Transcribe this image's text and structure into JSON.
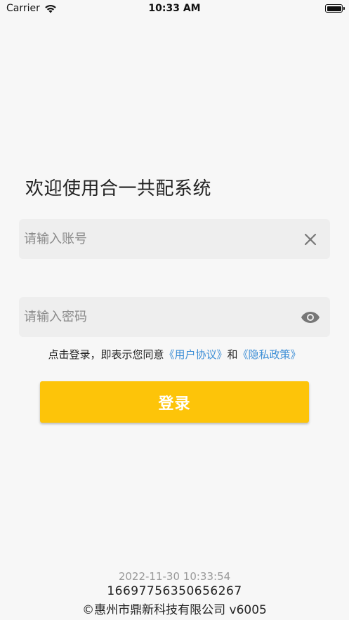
{
  "status_bar": {
    "carrier": "Carrier",
    "time": "10:33 AM"
  },
  "welcome": "欢迎使用合一共配系统",
  "account": {
    "placeholder": "请输入账号",
    "value": ""
  },
  "password": {
    "placeholder": "请输入密码",
    "value": ""
  },
  "agreement": {
    "prefix": "点击登录，即表示您同意",
    "user_agreement": "《用户协议》",
    "and": "和",
    "privacy_policy": "《隐私政策》"
  },
  "login_label": "登录",
  "footer": {
    "datetime": "2022-11-30 10:33:54",
    "id": "16697756350656267",
    "company": "©惠州市鼎新科技有限公司 v6005"
  },
  "colors": {
    "accent": "#fdc409",
    "link": "#3c8ed6"
  }
}
